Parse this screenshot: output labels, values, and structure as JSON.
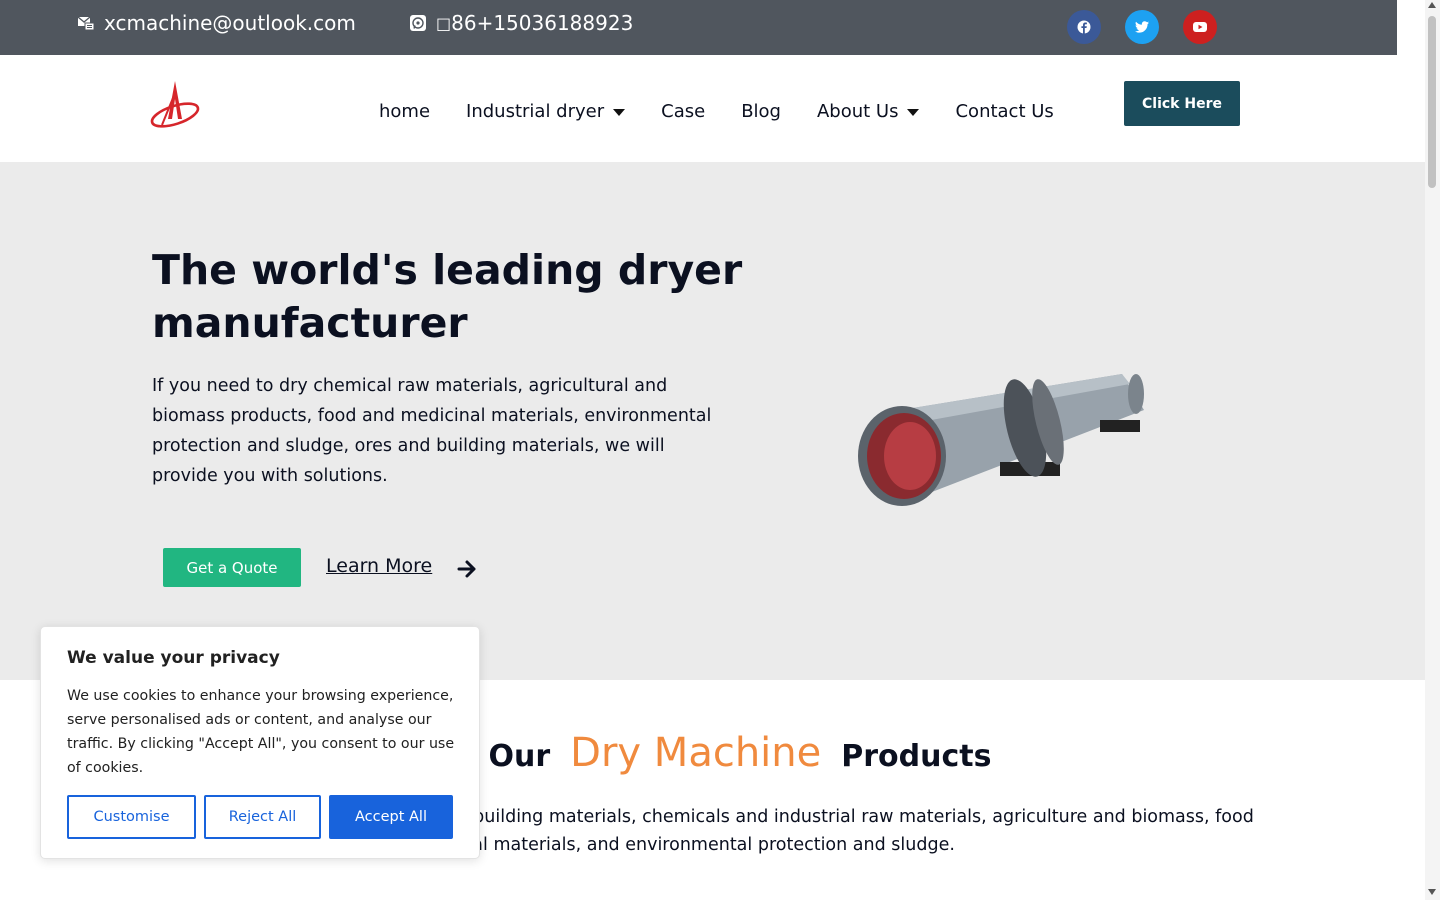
{
  "topbar": {
    "email": "xcmachine@outlook.com",
    "phone": "86+15036188923",
    "email_icon": "email-icon",
    "phone_icon": "whatsapp-icon",
    "social": [
      {
        "name": "facebook-icon",
        "color": "#3b5998"
      },
      {
        "name": "twitter-icon",
        "color": "#1da1f2"
      },
      {
        "name": "youtube-icon",
        "color": "#cd201f"
      }
    ]
  },
  "header": {
    "logo": "company-logo",
    "nav": [
      {
        "label": "home",
        "dropdown": false
      },
      {
        "label": "Industrial dryer",
        "dropdown": true
      },
      {
        "label": "Case",
        "dropdown": false
      },
      {
        "label": "Blog",
        "dropdown": false
      },
      {
        "label": "About Us",
        "dropdown": true
      },
      {
        "label": "Contact Us",
        "dropdown": false
      }
    ],
    "cta_label": "Click Here",
    "cta_color": "#1b4c5c"
  },
  "hero": {
    "title": "The world's leading dryer manufacturer",
    "description": "If you need to dry chemical raw materials, agricultural and biomass products, food and medicinal materials, environmental protection and sludge, ores and building materials, we will provide you with solutions.",
    "quote_label": "Get a Quote",
    "learn_label": "Learn More",
    "image": "rotary-dryer-image",
    "quote_color": "#21b681"
  },
  "products": {
    "title_pre": "ew Our",
    "title_accent": "Dry Machine",
    "title_post": "Products",
    "description": "s and building materials, chemicals and industrial raw materials, agriculture and biomass, food edicinal materials, and environmental protection and sludge.",
    "accent_color": "#f08a3e"
  },
  "cookie": {
    "title": "We value your privacy",
    "text": "We use cookies to enhance your browsing experience, serve personalised ads or content, and analyse our traffic. By clicking \"Accept All\", you consent to our use of cookies.",
    "customise_label": "Customise",
    "reject_label": "Reject All",
    "accept_label": "Accept All",
    "button_color": "#1863dc"
  }
}
